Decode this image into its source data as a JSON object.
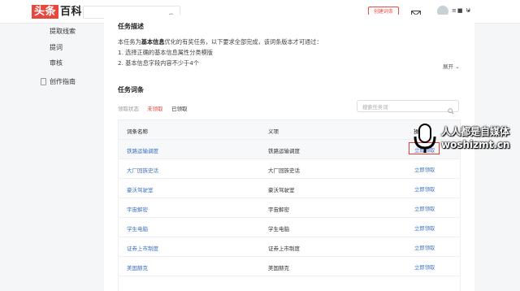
{
  "header": {
    "logo_left": "头条",
    "logo_right": "百科",
    "create_label": "创建词条",
    "username": "≡■ U"
  },
  "sidebar": {
    "items": [
      {
        "label": "提取线索"
      },
      {
        "label": "提词"
      },
      {
        "label": "审核"
      },
      {
        "label": "创作指南"
      }
    ]
  },
  "task": {
    "title": "任务描述",
    "intro_prefix": "本任务为",
    "intro_bold": "基本信息",
    "intro_suffix": "优化的有奖任务，以下要求全部完成，该词条版本才可通过：",
    "req1": "1. 选择正确的基本信息属性分类模版",
    "req2": "2. 基本信息字段内容不少于4个",
    "expand_label": "展开"
  },
  "words": {
    "title": "任务词条",
    "filter_label": "领取状态",
    "filter_unclaimed": "未领取",
    "filter_claimed": "已领取",
    "search_placeholder": "搜索任务词",
    "col_name": "词条名称",
    "col_def": "义项",
    "col_action": "操作",
    "rows": [
      {
        "name": "铁路运输调度",
        "def": "铁路运输调度",
        "action": "立即领取"
      },
      {
        "name": "大厂回族史话",
        "def": "大厂回族史话",
        "action": "立即领取"
      },
      {
        "name": "豪沃驾驶室",
        "def": "豪沃驾驶室",
        "action": "立即领取"
      },
      {
        "name": "宇宙解密",
        "def": "宇宙解密",
        "action": "立即领取"
      },
      {
        "name": "学生电脑",
        "def": "学生电脑",
        "action": "立即领取"
      },
      {
        "name": "证券上市制度",
        "def": "证券上市制度",
        "action": "立即领取"
      },
      {
        "name": "美国赫克",
        "def": "美国赫克",
        "action": "立即领取"
      }
    ]
  },
  "watermark": {
    "line1": "人人都是自媒体",
    "line2": "woshizmt.cn"
  },
  "colors": {
    "accent_red": "#e8473b",
    "link_blue": "#3b6fc4"
  }
}
